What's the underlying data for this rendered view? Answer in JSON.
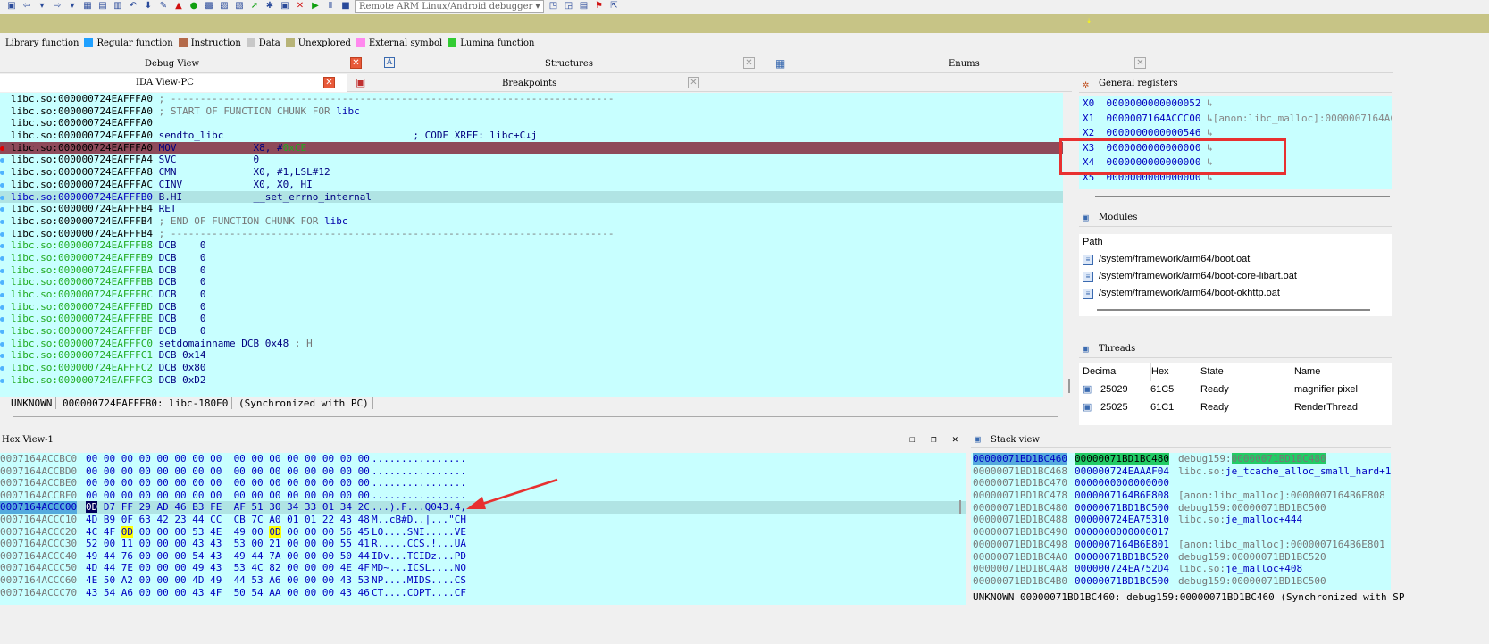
{
  "toolbar": {
    "debugger_select": "Remote ARM Linux/Android debugger",
    "icons": [
      "save-icon",
      "back-icon",
      "forward-icon",
      "segments-icon",
      "structs-icon",
      "enums-icon",
      "undo-icon",
      "down-icon",
      "func-icon",
      "graph-icon",
      "run-icon",
      "pause-icon",
      "stop-icon",
      "refresh-icon",
      "red-x-icon",
      "play-icon"
    ]
  },
  "legend": {
    "items": [
      {
        "label": "Library function",
        "color": "#1fa0ff"
      },
      {
        "label": "Regular function",
        "color": "#b46a4a"
      },
      {
        "label": "Instruction",
        "color": "#c8c8c8"
      },
      {
        "label": "Data",
        "color": "#b8b478"
      },
      {
        "label": "Unexplored",
        "color": "#ff88ee"
      },
      {
        "label": "External symbol",
        "color": "#33cc33"
      },
      {
        "label": "Lumina function",
        "color": ""
      }
    ]
  },
  "tabs": {
    "debug_view": "Debug View",
    "structures": "Structures",
    "enums": "Enums",
    "ida_view": "IDA View-PC",
    "breakpoints": "Breakpoints"
  },
  "ida": {
    "lines": [
      {
        "addr": "libc.so:000000724EAFFFA0",
        "text": " ; ---------------------------------------------------------------------------",
        "kind": "cmt"
      },
      {
        "addr": "libc.so:000000724EAFFFA0",
        "text": " ; START OF FUNCTION CHUNK FOR ",
        "extra": "libc",
        "kind": "cmt"
      },
      {
        "addr": "libc.so:000000724EAFFFA0",
        "text": "",
        "kind": "plain"
      },
      {
        "addr": "libc.so:000000724EAFFFA0",
        "text": " sendto_libc                                ",
        "extra": "; CODE XREF: libc+C↓j",
        "kind": "label"
      },
      {
        "addr": "libc.so:000000724EAFFFA0",
        "text": " MOV             X8, #",
        "extra": "0xCE",
        "kind": "pc"
      },
      {
        "addr": "libc.so:000000724EAFFFA4",
        "text": " SVC             0",
        "kind": "code"
      },
      {
        "addr": "libc.so:000000724EAFFFA8",
        "text": " CMN             X0, #1,LSL#12",
        "kind": "code"
      },
      {
        "addr": "libc.so:000000724EAFFFAC",
        "text": " CINV            X0, X0, HI",
        "kind": "code"
      },
      {
        "addr": "libc.so:000000724EAFFFB0",
        "text": " B.HI            __set_errno_internal",
        "kind": "sel"
      },
      {
        "addr": "libc.so:000000724EAFFFB4",
        "text": " RET",
        "kind": "code"
      },
      {
        "addr": "libc.so:000000724EAFFFB4",
        "text": " ; END OF FUNCTION CHUNK FOR ",
        "extra": "libc",
        "kind": "cmt"
      },
      {
        "addr": "libc.so:000000724EAFFFB4",
        "text": " ; ---------------------------------------------------------------------------",
        "kind": "cmt"
      },
      {
        "addr": "libc.so:000000724EAFFFB8",
        "text": " DCB    0",
        "kind": "data"
      },
      {
        "addr": "libc.so:000000724EAFFFB9",
        "text": " DCB    0",
        "kind": "data"
      },
      {
        "addr": "libc.so:000000724EAFFFBA",
        "text": " DCB    0",
        "kind": "data"
      },
      {
        "addr": "libc.so:000000724EAFFFBB",
        "text": " DCB    0",
        "kind": "data"
      },
      {
        "addr": "libc.so:000000724EAFFFBC",
        "text": " DCB    0",
        "kind": "data"
      },
      {
        "addr": "libc.so:000000724EAFFFBD",
        "text": " DCB    0",
        "kind": "data"
      },
      {
        "addr": "libc.so:000000724EAFFFBE",
        "text": " DCB    0",
        "kind": "data"
      },
      {
        "addr": "libc.so:000000724EAFFFBF",
        "text": " DCB    0",
        "kind": "data"
      },
      {
        "addr": "libc.so:000000724EAFFFC0",
        "text": " setdomainname DCB 0x48 ",
        "extra": "; H",
        "kind": "data"
      },
      {
        "addr": "libc.so:000000724EAFFFC1",
        "text": " DCB 0x14",
        "kind": "data"
      },
      {
        "addr": "libc.so:000000724EAFFFC2",
        "text": " DCB 0x80",
        "kind": "data"
      },
      {
        "addr": "libc.so:000000724EAFFFC3",
        "text": " DCB 0xD2",
        "kind": "data"
      }
    ],
    "status_a": "UNKNOWN",
    "status_b": "000000724EAFFFB0: libc-180E0",
    "status_c": "(Synchronized with PC)"
  },
  "registers": {
    "title": "General registers",
    "items": [
      {
        "name": "X0",
        "value": "0000000000000052",
        "note": ""
      },
      {
        "name": "X1",
        "value": "0000007164ACCC00",
        "note": "[anon:libc_malloc]:0000007164AC"
      },
      {
        "name": "X2",
        "value": "0000000000000546",
        "note": ""
      },
      {
        "name": "X3",
        "value": "0000000000000000",
        "note": ""
      },
      {
        "name": "X4",
        "value": "0000000000000000",
        "note": ""
      },
      {
        "name": "X5",
        "value": "0000000000000000",
        "note": ""
      }
    ]
  },
  "modules": {
    "title": "Modules",
    "header": "Path",
    "items": [
      "/system/framework/arm64/boot.oat",
      "/system/framework/arm64/boot-core-libart.oat",
      "/system/framework/arm64/boot-okhttp.oat"
    ]
  },
  "threads": {
    "title": "Threads",
    "headers": [
      "Decimal",
      "Hex",
      "State",
      "Name"
    ],
    "rows": [
      [
        "25029",
        "61C5",
        "Ready",
        "magnifier pixel"
      ],
      [
        "25025",
        "61C1",
        "Ready",
        "RenderThread"
      ]
    ]
  },
  "hex": {
    "title": "Hex View-1",
    "lines": [
      {
        "addr": "0007164ACCBC0",
        "bytes": "00 00 00 00 00 00 00 00  00 00 00 00 00 00 00 00",
        "ascii": "................"
      },
      {
        "addr": "0007164ACCBD0",
        "bytes": "00 00 00 00 00 00 00 00  00 00 00 00 00 00 00 00",
        "ascii": "................"
      },
      {
        "addr": "0007164ACCBE0",
        "bytes": "00 00 00 00 00 00 00 00  00 00 00 00 00 00 00 00",
        "ascii": "................"
      },
      {
        "addr": "0007164ACCBF0",
        "bytes": "00 00 00 00 00 00 00 00  00 00 00 00 00 00 00 00",
        "ascii": "................"
      },
      {
        "addr": "0007164ACCC00",
        "bytes": "0D D7 FF 29 AD 46 B3 FE  AF 51 30 34 33 01 34 2C",
        "ascii": "...).F...Q043.4,"
      },
      {
        "addr": "0007164ACCC10",
        "bytes": "4D B9 0F 63 42 23 44 CC  CB 7C A0 01 01 22 43 48",
        "ascii": "M..cB#D..|...\"CH"
      },
      {
        "addr": "0007164ACCC20",
        "bytes": "4C 4F 0D 00 00 00 53 4E  49 00 0D 00 00 00 56 45",
        "ascii": "LO....SNI.....VE"
      },
      {
        "addr": "0007164ACCC30",
        "bytes": "52 00 11 00 00 00 43 43  53 00 21 00 00 00 55 41",
        "ascii": "R.....CCS.!...UA"
      },
      {
        "addr": "0007164ACCC40",
        "bytes": "49 44 76 00 00 00 54 43  49 44 7A 00 00 00 50 44",
        "ascii": "IDv...TCIDz...PD"
      },
      {
        "addr": "0007164ACCC50",
        "bytes": "4D 44 7E 00 00 00 49 43  53 4C 82 00 00 00 4E 4F",
        "ascii": "MD~...ICSL....NO"
      },
      {
        "addr": "0007164ACCC60",
        "bytes": "4E 50 A2 00 00 00 4D 49  44 53 A6 00 00 00 43 53",
        "ascii": "NP....MIDS....CS"
      },
      {
        "addr": "0007164ACCC70",
        "bytes": "43 54 A6 00 00 00 43 4F  50 54 AA 00 00 00 43 46",
        "ascii": "CT....COPT....CF"
      }
    ]
  },
  "stack": {
    "title": "Stack view",
    "lines": [
      {
        "addr": "00000071BD1BC460",
        "val": "00000071BD1BC480",
        "pre": "debug159:",
        "sym": "00000071BD1BC480"
      },
      {
        "addr": "00000071BD1BC468",
        "val": "000000724EAAAF04",
        "pre": "libc.so:",
        "sym": "je_tcache_alloc_small_hard+1C"
      },
      {
        "addr": "00000071BD1BC470",
        "val": "0000000000000000",
        "pre": "",
        "sym": ""
      },
      {
        "addr": "00000071BD1BC478",
        "val": "0000007164B6E808",
        "pre": "[anon:libc_malloc]:0000007164B6E808",
        "sym": ""
      },
      {
        "addr": "00000071BD1BC480",
        "val": "00000071BD1BC500",
        "pre": "debug159:00000071BD1BC500",
        "sym": ""
      },
      {
        "addr": "00000071BD1BC488",
        "val": "000000724EA75310",
        "pre": "libc.so:",
        "sym": "je_malloc+444"
      },
      {
        "addr": "00000071BD1BC490",
        "val": "0000000000000017",
        "pre": "",
        "sym": ""
      },
      {
        "addr": "00000071BD1BC498",
        "val": "0000007164B6E801",
        "pre": "[anon:libc_malloc]:0000007164B6E801",
        "sym": ""
      },
      {
        "addr": "00000071BD1BC4A0",
        "val": "00000071BD1BC520",
        "pre": "debug159:00000071BD1BC520",
        "sym": ""
      },
      {
        "addr": "00000071BD1BC4A8",
        "val": "000000724EA752D4",
        "pre": "libc.so:",
        "sym": "je_malloc+408"
      },
      {
        "addr": "00000071BD1BC4B0",
        "val": "00000071BD1BC500",
        "pre": "debug159:00000071BD1BC500",
        "sym": ""
      }
    ],
    "status": "UNKNOWN 00000071BD1BC460: debug159:00000071BD1BC460 (Synchronized with SP"
  }
}
